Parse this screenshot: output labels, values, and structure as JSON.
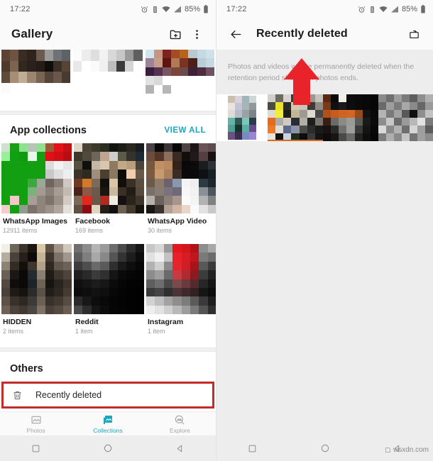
{
  "status_bar": {
    "time": "17:22",
    "battery_percent": "85%",
    "icons": [
      "alarm-icon",
      "vibrate-icon",
      "wifi-icon",
      "signal-icon",
      "battery-icon"
    ]
  },
  "left_screen": {
    "app_bar": {
      "title": "Gallery",
      "actions": [
        "new-album-icon",
        "overflow-menu-icon"
      ]
    },
    "app_collections": {
      "header": "App collections",
      "view_all": "VIEW ALL",
      "albums": [
        {
          "name": "WhatsApp Images",
          "count": "12911 items"
        },
        {
          "name": "Facebook",
          "count": "169 items"
        },
        {
          "name": "WhatsApp Video",
          "count": "30 items"
        },
        {
          "name": "HIDDEN",
          "count": "2 items"
        },
        {
          "name": "Reddit",
          "count": "1 item"
        },
        {
          "name": "Instagram",
          "count": "1 item"
        }
      ]
    },
    "others": {
      "header": "Others",
      "row_label": "Recently deleted",
      "row_icon": "trash-icon",
      "highlight_color": "#c42b2b"
    },
    "bottom_nav": {
      "items": [
        {
          "label": "Photos",
          "icon": "photos-icon",
          "active": false
        },
        {
          "label": "Collections",
          "icon": "collections-icon",
          "active": true
        },
        {
          "label": "Explore",
          "icon": "explore-icon",
          "active": false
        }
      ],
      "active_color": "#1aa7bd"
    }
  },
  "right_screen": {
    "app_bar": {
      "back_icon": "back-arrow-icon",
      "title": "Recently deleted",
      "action_icon": "restore-bin-icon"
    },
    "notice": "Photos and videos will be permanently deleted when the retention period shown on photos ends.",
    "thumbnail_count": 4,
    "selected_thumbnail_index": 1,
    "annotation": {
      "type": "arrow-up",
      "color": "#e8232a"
    }
  },
  "system_nav": {
    "buttons": [
      "recents-button",
      "home-button",
      "back-button"
    ]
  },
  "watermark": "wsxdn.com"
}
